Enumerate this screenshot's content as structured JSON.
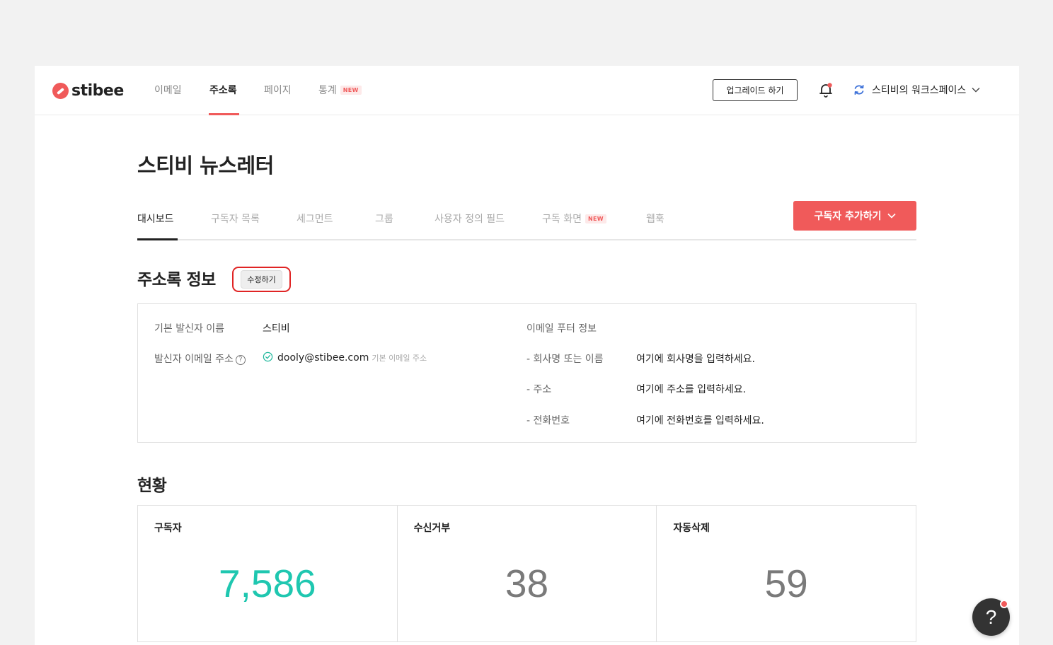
{
  "brand": {
    "name": "stibee",
    "accent": "#f05a5a",
    "positive": "#1fc7b0"
  },
  "topnav": {
    "items": [
      {
        "label": "이메일"
      },
      {
        "label": "주소록"
      },
      {
        "label": "페이지"
      },
      {
        "label": "통계",
        "badge": "NEW"
      }
    ],
    "active": "주소록",
    "upgrade_label": "업그레이드 하기",
    "workspace_label": "스티비의 워크스페이스",
    "icons": [
      "bell-icon",
      "refresh-icon",
      "chevron-down-icon"
    ]
  },
  "page": {
    "title": "스티비 뉴스레터"
  },
  "subtabs": {
    "items": [
      {
        "label": "대시보드"
      },
      {
        "label": "구독자 목록"
      },
      {
        "label": "세그먼트"
      },
      {
        "label": "그룹"
      },
      {
        "label": "사용자 정의 필드"
      },
      {
        "label": "구독 화면",
        "badge": "NEW"
      },
      {
        "label": "웹훅"
      }
    ],
    "active": "대시보드",
    "add_label": "구독자 추가하기"
  },
  "info": {
    "title": "주소록 정보",
    "edit_label": "수정하기",
    "sender_name_label": "기본 발신자 이름",
    "sender_name_value": "스티비",
    "sender_email_label": "발신자 이메일 주소",
    "sender_email_help": "?",
    "sender_email_value": "dooly@stibee.com",
    "sender_email_note": "기본 이메일 주소",
    "footer_title": "이메일 푸터 정보",
    "footer_rows": [
      {
        "label": "- 회사명 또는 이름",
        "value": "여기에 회사명을 입력하세요."
      },
      {
        "label": "- 주소",
        "value": "여기에 주소를 입력하세요."
      },
      {
        "label": "- 전화번호",
        "value": "여기에 전화번호를 입력하세요."
      }
    ]
  },
  "status": {
    "title": "현황",
    "cards": [
      {
        "label": "구독자",
        "value": "7,586"
      },
      {
        "label": "수신거부",
        "value": "38"
      },
      {
        "label": "자동삭제",
        "value": "59"
      }
    ]
  },
  "help": {
    "label": "?"
  }
}
